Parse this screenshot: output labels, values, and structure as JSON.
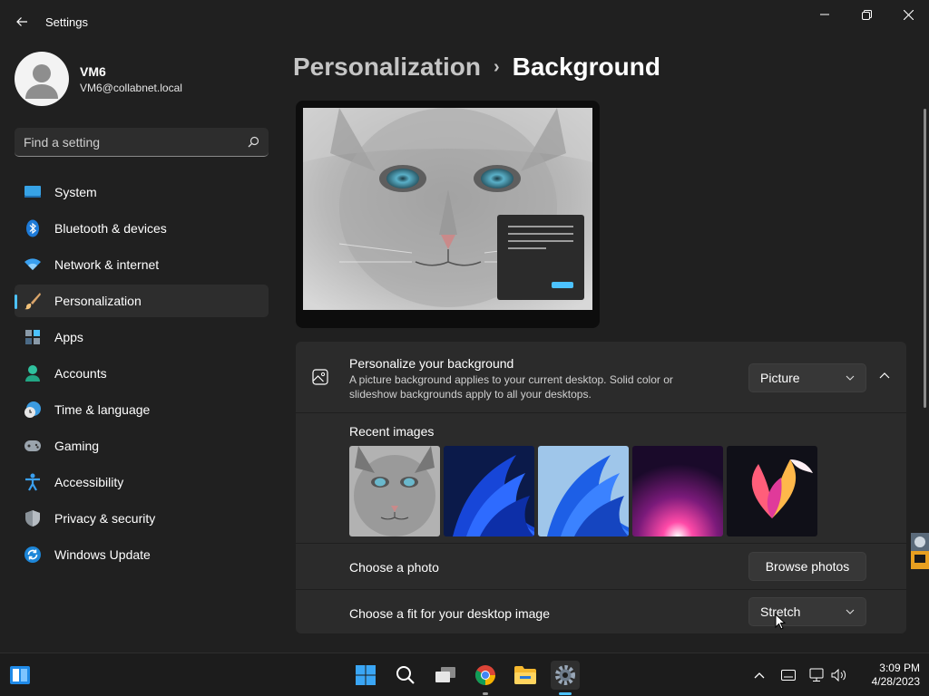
{
  "window": {
    "title": "Settings"
  },
  "profile": {
    "name": "VM6",
    "email": "VM6@collabnet.local"
  },
  "search": {
    "placeholder": "Find a setting"
  },
  "sidebar": {
    "items": [
      {
        "label": "System",
        "icon": "monitor-icon"
      },
      {
        "label": "Bluetooth & devices",
        "icon": "bluetooth-icon"
      },
      {
        "label": "Network & internet",
        "icon": "wifi-icon"
      },
      {
        "label": "Personalization",
        "icon": "brush-icon",
        "active": true
      },
      {
        "label": "Apps",
        "icon": "apps-icon"
      },
      {
        "label": "Accounts",
        "icon": "person-icon"
      },
      {
        "label": "Time & language",
        "icon": "clock-globe-icon"
      },
      {
        "label": "Gaming",
        "icon": "gamepad-icon"
      },
      {
        "label": "Accessibility",
        "icon": "accessibility-icon"
      },
      {
        "label": "Privacy & security",
        "icon": "shield-icon"
      },
      {
        "label": "Windows Update",
        "icon": "refresh-icon"
      }
    ]
  },
  "breadcrumb": {
    "parent": "Personalization",
    "current": "Background"
  },
  "background": {
    "title": "Personalize your background",
    "description": "A picture background applies to your current desktop. Solid color or slideshow backgrounds apply to all your desktops.",
    "type_value": "Picture",
    "recent_label": "Recent images",
    "choose_photo_label": "Choose a photo",
    "browse_button": "Browse photos",
    "fit_label": "Choose a fit for your desktop image",
    "fit_value": "Stretch"
  },
  "taskbar": {
    "time": "3:09 PM",
    "date": "4/28/2023"
  },
  "colors": {
    "accent": "#4cc2ff",
    "background": "#202020",
    "card": "#2b2b2b"
  }
}
